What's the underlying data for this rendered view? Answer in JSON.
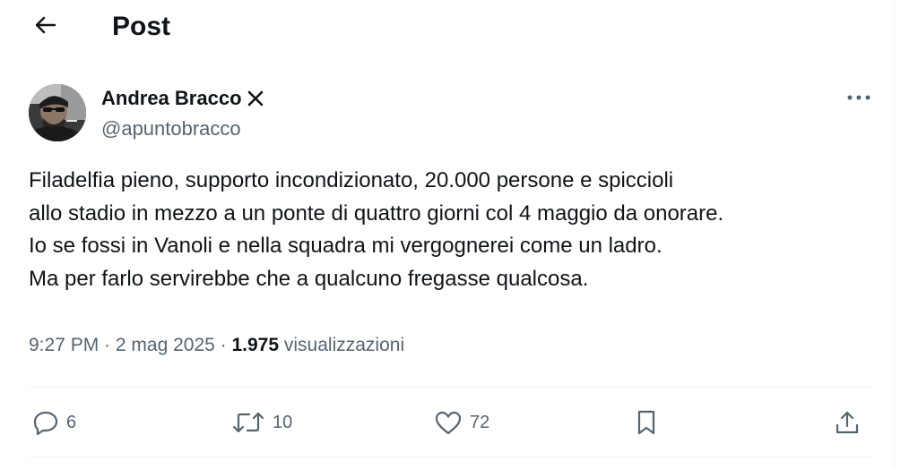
{
  "header": {
    "title": "Post",
    "back_icon": "arrow-left-icon"
  },
  "author": {
    "name": "Andrea Bracco",
    "handle": "@apuntobracco",
    "badge_icon": "x-icon",
    "avatar_icon": "avatar-photo"
  },
  "more_icon": "ellipsis-icon",
  "tweet": {
    "lines": [
      "Filadelfia pieno, supporto incondizionato, 20.000 persone e spiccioli",
      "allo stadio in mezzo a un ponte di quattro giorni col 4 maggio da onorare.",
      "Io se fossi in Vanoli e nella squadra mi vergognerei come un ladro.",
      "Ma per farlo servirebbe che a qualcuno fregasse qualcosa."
    ]
  },
  "meta": {
    "time": "9:27 PM",
    "sep1": " · ",
    "date": "2 mag 2025",
    "sep2": " · ",
    "views_count": "1.975",
    "views_label": " visualizzazioni"
  },
  "actions": {
    "reply": {
      "icon": "reply-icon",
      "count": "6"
    },
    "repost": {
      "icon": "repost-icon",
      "count": "10"
    },
    "like": {
      "icon": "heart-icon",
      "count": "72"
    },
    "bookmark": {
      "icon": "bookmark-icon"
    },
    "share": {
      "icon": "share-icon"
    }
  },
  "colors": {
    "text_primary": "#0f1419",
    "text_secondary": "#536471",
    "divider": "#eff3f4",
    "background": "#ffffff"
  }
}
